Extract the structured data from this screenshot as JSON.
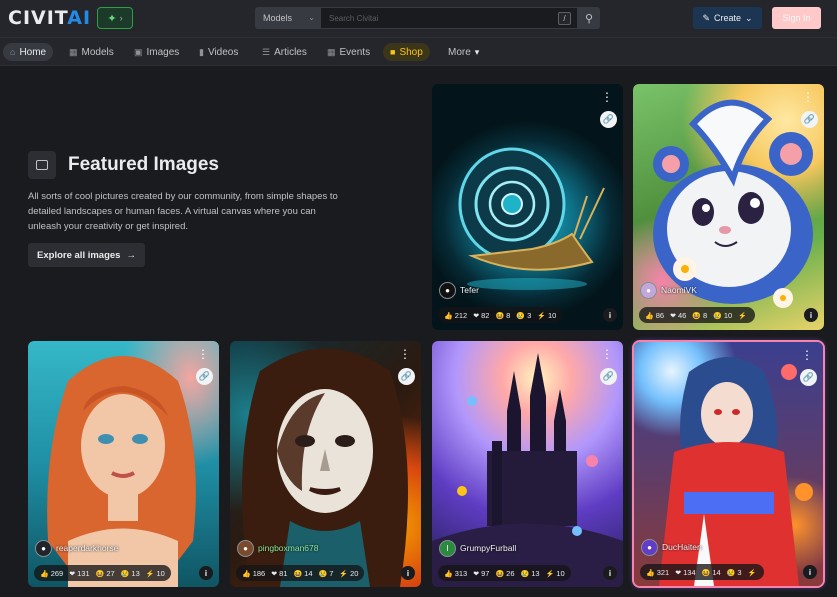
{
  "header": {
    "logo_main": "CIVIT",
    "logo_accent": "AI",
    "badge_text": "",
    "search_scope": "Models",
    "search_placeholder": "Search Civitai",
    "search_shortcut": "/",
    "create_label": "Create",
    "signin_label": "Sign In"
  },
  "nav": {
    "items": [
      {
        "label": "Home",
        "icon": "home-icon"
      },
      {
        "label": "Models",
        "icon": "models-icon"
      },
      {
        "label": "Images",
        "icon": "images-icon"
      },
      {
        "label": "Videos",
        "icon": "video-icon"
      },
      {
        "label": "Articles",
        "icon": "article-icon"
      },
      {
        "label": "Events",
        "icon": "calendar-icon"
      },
      {
        "label": "Shop",
        "icon": "shop-icon"
      },
      {
        "label": "More",
        "icon": "caret-down-icon"
      }
    ]
  },
  "featured": {
    "title": "Featured Images",
    "description": "All sorts of cool pictures created by our community, from simple shapes to detailed landscapes or human faces. A virtual canvas where you can unleash your creativity or get inspired.",
    "explore_label": "Explore all images"
  },
  "cards": [
    {
      "user": "Tefer",
      "likes": "212",
      "hearts": "82",
      "laughs": "8",
      "cries": "3",
      "buzz": "10"
    },
    {
      "user": "NaomiVK",
      "likes": "86",
      "hearts": "46",
      "laughs": "8",
      "cries": "10",
      "buzz": ""
    },
    {
      "user": "reaperdarkhorse",
      "likes": "269",
      "hearts": "131",
      "laughs": "27",
      "cries": "13",
      "buzz": "10"
    },
    {
      "user": "pingboxman678",
      "likes": "186",
      "hearts": "81",
      "laughs": "14",
      "cries": "7",
      "buzz": "20"
    },
    {
      "user": "GrumpyFurball",
      "likes": "313",
      "hearts": "97",
      "laughs": "26",
      "cries": "13",
      "buzz": "10"
    },
    {
      "user": "DucHaiten",
      "likes": "321",
      "hearts": "134",
      "laughs": "14",
      "cries": "3",
      "buzz": ""
    }
  ]
}
